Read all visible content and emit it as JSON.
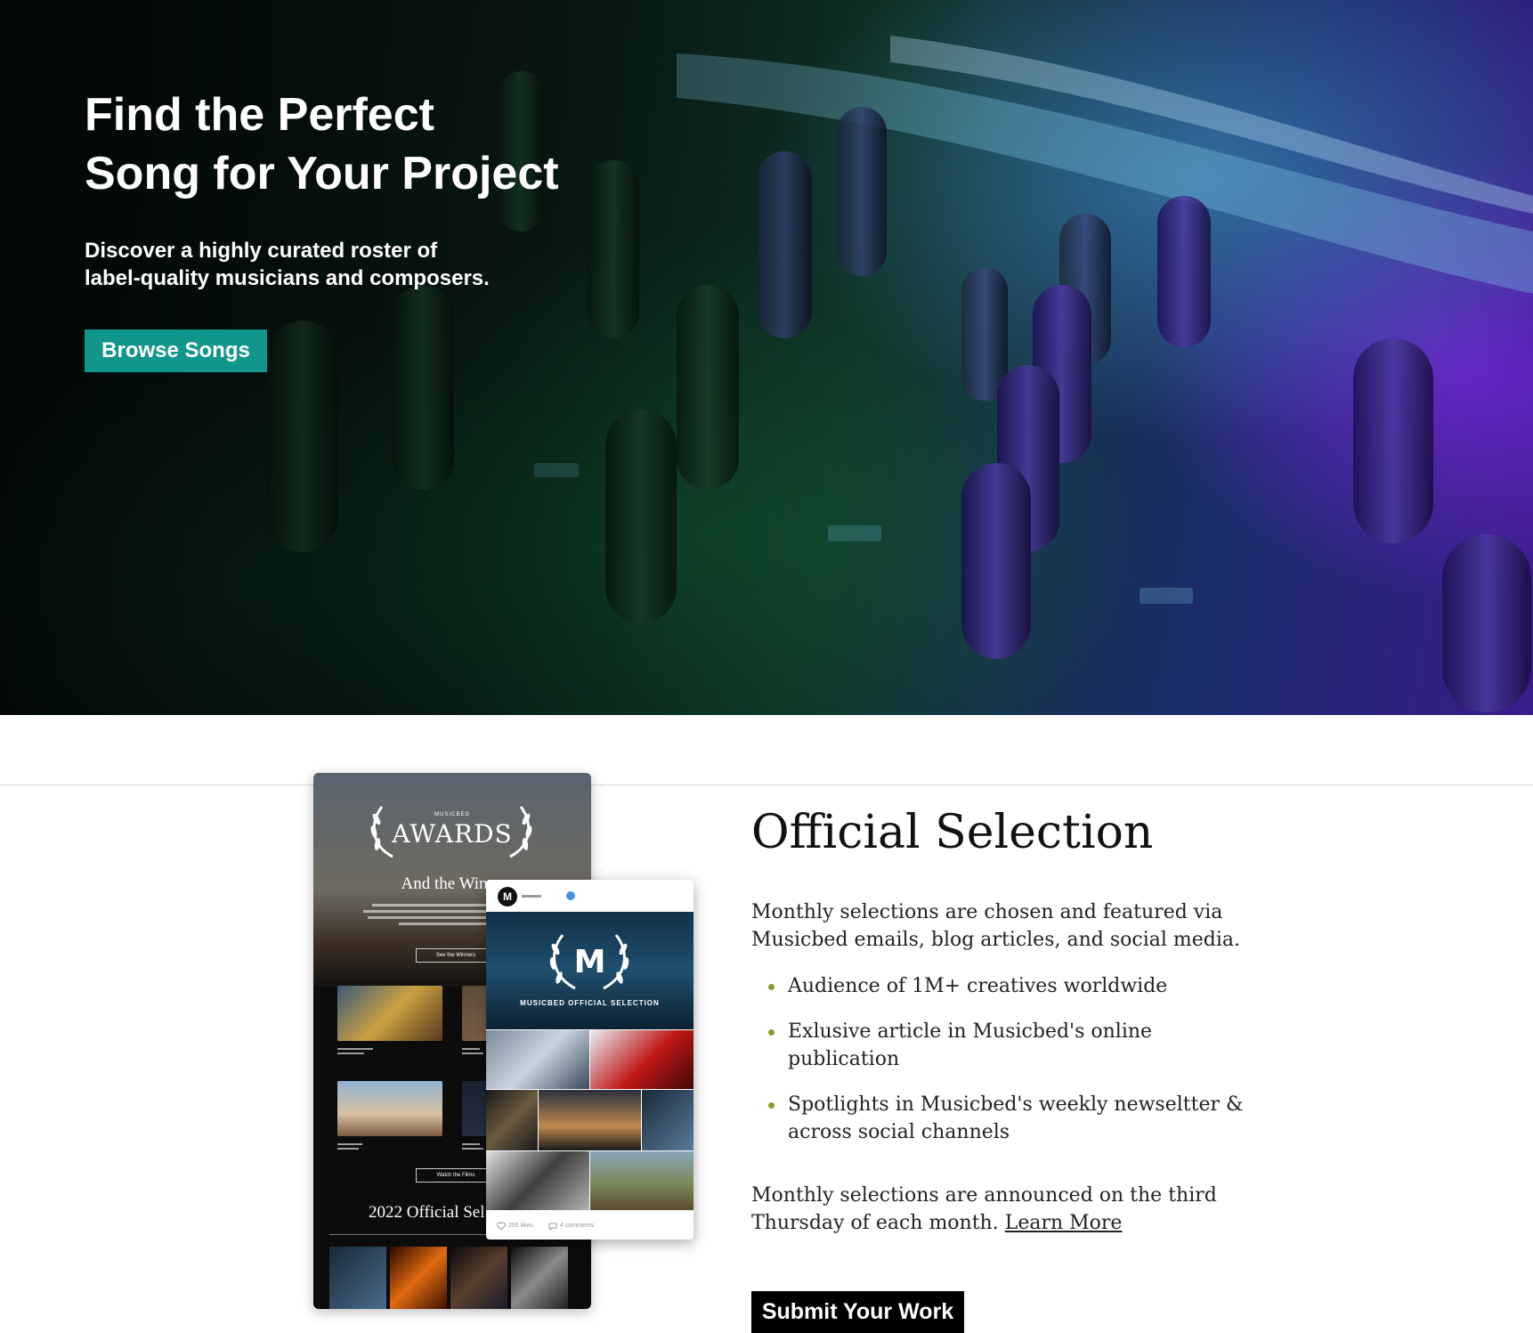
{
  "hero": {
    "title_lines": [
      "Find the Perfect",
      "Song for Your Project"
    ],
    "subtitle_lines": [
      "Discover a highly curated roster of",
      "label-quality musicians and composers."
    ],
    "browse_label": "Browse Songs"
  },
  "email_mock": {
    "brand_small": "MUSICBED",
    "awards": "AWARDS",
    "headline": "And the Winne",
    "button_1": "See the Winners",
    "button_2": "Watch the Films",
    "year_heading": "2022 Official Sel"
  },
  "social_mock": {
    "avatar_letter": "M",
    "monogram": "M",
    "caption": "MUSICBED OFFICIAL SELECTION",
    "likes": "255 likes",
    "comments": "4 comments"
  },
  "selection": {
    "title": "Official Selection",
    "intro_lines": [
      "Monthly selections are chosen and featured via",
      "Musicbed emails, blog articles, and social media."
    ],
    "bullets": [
      {
        "lines": [
          "Audience of 1M+ creatives worldwide"
        ]
      },
      {
        "lines": [
          "Exlusive article in Musicbed's online",
          "publication"
        ]
      },
      {
        "lines": [
          "Spotlights in Musicbed's weekly newseltter &",
          "across social channels"
        ]
      }
    ],
    "announce_line_1": "Monthly selections are announced on the third",
    "announce_line_2": "Thursday of each month.",
    "learn_more": "Learn More",
    "submit_label": "Submit Your Work"
  },
  "colors": {
    "accent_teal": "#10968a",
    "bullet_olive": "#8a9a2a",
    "submit_black": "#000000"
  }
}
